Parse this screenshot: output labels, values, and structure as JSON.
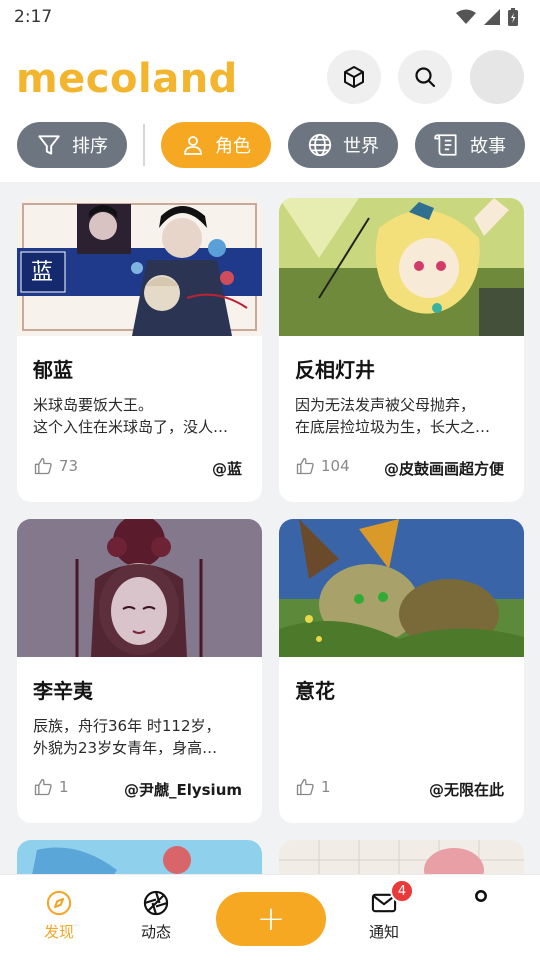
{
  "status_bar": {
    "time": "2:17"
  },
  "app": {
    "logo_text": "mecoland",
    "brand_color": "#f4b52e",
    "accent_color": "#f7a823"
  },
  "header": {
    "icons": [
      "cube-icon",
      "search-icon",
      "avatar"
    ]
  },
  "filters": [
    {
      "label": "排序",
      "icon": "filter-icon",
      "active": false
    },
    {
      "label": "角色",
      "icon": "person-icon",
      "active": true
    },
    {
      "label": "世界",
      "icon": "globe-icon",
      "active": false
    },
    {
      "label": "故事",
      "icon": "scroll-icon",
      "active": false
    }
  ],
  "cards": [
    {
      "name": "郁蓝",
      "desc_line1": "米球岛要饭大王。",
      "desc_line2": "这个入住在米球岛了，没人…",
      "likes": "73",
      "author": "@蓝",
      "cover_badge": "蓝"
    },
    {
      "name": "反相灯井",
      "desc_line1": "因为无法发声被父母抛弃，",
      "desc_line2": "在底层捡垃圾为生，长大之…",
      "likes": "104",
      "author": "@皮鼓画画超方便"
    },
    {
      "name": "李辛夷",
      "desc_line1": "辰族，舟行36年 时112岁，",
      "desc_line2": "外貌为23岁女青年，身高…",
      "likes": "1",
      "author": "@尹虤_Elysium"
    },
    {
      "name": "意花",
      "desc_line1": "",
      "desc_line2": "",
      "likes": "1",
      "author": "@无限在此"
    }
  ],
  "bottom_nav": {
    "discover": "发现",
    "feed": "动态",
    "notifications": "通知",
    "notifications_badge": "4",
    "add": "+"
  }
}
